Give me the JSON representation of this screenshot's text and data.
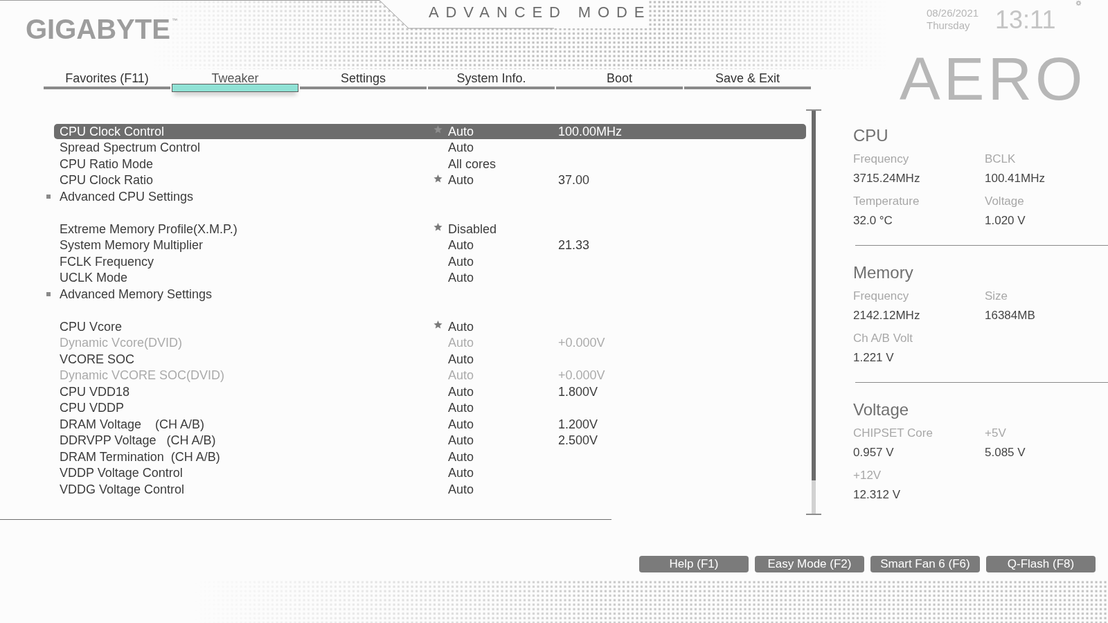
{
  "header": {
    "logo": "GIGABYTE$^{™}$",
    "mode_title": "ADVANCED MODE",
    "date": "08/26/2021",
    "weekday": "Thursday",
    "time": "13:11",
    "series_logo": "AERO"
  },
  "tabs": [
    {
      "label": "Favorites (F11)",
      "selected": false
    },
    {
      "label": "Tweaker",
      "selected": true
    },
    {
      "label": "Settings",
      "selected": false
    },
    {
      "label": "System Info.",
      "selected": false
    },
    {
      "label": "Boot",
      "selected": false
    },
    {
      "label": "Save & Exit",
      "selected": false
    }
  ],
  "settings_groups": [
    {
      "items": [
        {
          "kind": "setting",
          "label": "CPU Clock Control",
          "starred": true,
          "value": "Auto",
          "value_2": "100.00MHz",
          "selected": true,
          "disabled": false
        },
        {
          "kind": "setting",
          "label": "Spread Spectrum Control",
          "starred": false,
          "value": "Auto",
          "selected": false,
          "disabled": false
        },
        {
          "kind": "setting",
          "label": "CPU Ratio Mode",
          "starred": false,
          "value": "All cores",
          "selected": false,
          "disabled": false
        },
        {
          "kind": "setting",
          "label": "CPU Clock Ratio",
          "starred": true,
          "value": "Auto",
          "value_2": "37.00",
          "selected": false,
          "disabled": false
        },
        {
          "kind": "submenu",
          "label": "Advanced CPU Settings",
          "starred": false,
          "selected": false,
          "disabled": false
        }
      ]
    },
    {
      "items": [
        {
          "kind": "setting",
          "label": "Extreme Memory Profile(X.M.P.)",
          "starred": true,
          "value": "Disabled",
          "selected": false,
          "disabled": false
        },
        {
          "kind": "setting",
          "label": "System Memory Multiplier",
          "starred": false,
          "value": "Auto",
          "value_2": "21.33",
          "selected": false,
          "disabled": false
        },
        {
          "kind": "setting",
          "label": "FCLK Frequency",
          "starred": false,
          "value": "Auto",
          "selected": false,
          "disabled": false
        },
        {
          "kind": "setting",
          "label": "UCLK Mode",
          "starred": false,
          "value": "Auto",
          "selected": false,
          "disabled": false
        },
        {
          "kind": "submenu",
          "label": "Advanced Memory Settings",
          "starred": false,
          "selected": false,
          "disabled": false
        }
      ]
    },
    {
      "items": [
        {
          "kind": "setting",
          "label": "CPU Vcore",
          "starred": true,
          "value": "Auto",
          "selected": false,
          "disabled": false
        },
        {
          "kind": "setting",
          "label": "Dynamic Vcore(DVID)",
          "starred": false,
          "value": "Auto",
          "value_2": "+0.000V",
          "selected": false,
          "disabled": true
        },
        {
          "kind": "setting",
          "label": "VCORE SOC",
          "starred": false,
          "value": "Auto",
          "selected": false,
          "disabled": false
        },
        {
          "kind": "setting",
          "label": "Dynamic VCORE SOC(DVID)",
          "starred": false,
          "value": "Auto",
          "value_2": "+0.000V",
          "selected": false,
          "disabled": true
        },
        {
          "kind": "setting",
          "label": "CPU VDD18",
          "starred": false,
          "value": "Auto",
          "value_2": "1.800V",
          "selected": false,
          "disabled": false
        },
        {
          "kind": "setting",
          "label": "CPU VDDP",
          "starred": false,
          "value": "Auto",
          "selected": false,
          "disabled": false
        },
        {
          "kind": "setting",
          "label": "DRAM Voltage    (CH A/B)",
          "starred": false,
          "value": "Auto",
          "value_2": "1.200V",
          "selected": false,
          "disabled": false
        },
        {
          "kind": "setting",
          "label": "DDRVPP Voltage   (CH A/B)",
          "starred": false,
          "value": "Auto",
          "value_2": "2.500V",
          "selected": false,
          "disabled": false
        },
        {
          "kind": "setting",
          "label": "DRAM Termination  (CH A/B)",
          "starred": false,
          "value": "Auto",
          "selected": false,
          "disabled": false
        },
        {
          "kind": "setting",
          "label": "VDDP Voltage Control",
          "starred": false,
          "value": "Auto",
          "selected": false,
          "disabled": false
        },
        {
          "kind": "setting",
          "label": "VDDG Voltage Control",
          "starred": false,
          "value": "Auto",
          "selected": false,
          "disabled": false
        }
      ]
    }
  ],
  "hardware_monitor": {
    "sections": [
      {
        "title": "CPU",
        "readings": [
          {
            "label": "Frequency",
            "value": "3715.24MHz"
          },
          {
            "label": "BCLK",
            "value": "100.41MHz"
          },
          {
            "label": "Temperature",
            "value": "32.0 °C"
          },
          {
            "label": "Voltage",
            "value": "1.020 V"
          }
        ]
      },
      {
        "title": "Memory",
        "readings": [
          {
            "label": "Frequency",
            "value": "2142.12MHz"
          },
          {
            "label": "Size",
            "value": "16384MB"
          },
          {
            "label": "Ch A/B Volt",
            "value": "1.221 V"
          }
        ]
      },
      {
        "title": "Voltage",
        "readings": [
          {
            "label": "CHIPSET Core",
            "value": "0.957 V"
          },
          {
            "label": "+5V",
            "value": "5.085 V"
          },
          {
            "label": "+12V",
            "value": "12.312 V"
          }
        ]
      }
    ]
  },
  "buttons": [
    {
      "label": "Help (F1)"
    },
    {
      "label": "Easy Mode (F2)"
    },
    {
      "label": "Smart Fan 6 (F6)"
    },
    {
      "label": "Q-Flash (F8)"
    }
  ]
}
